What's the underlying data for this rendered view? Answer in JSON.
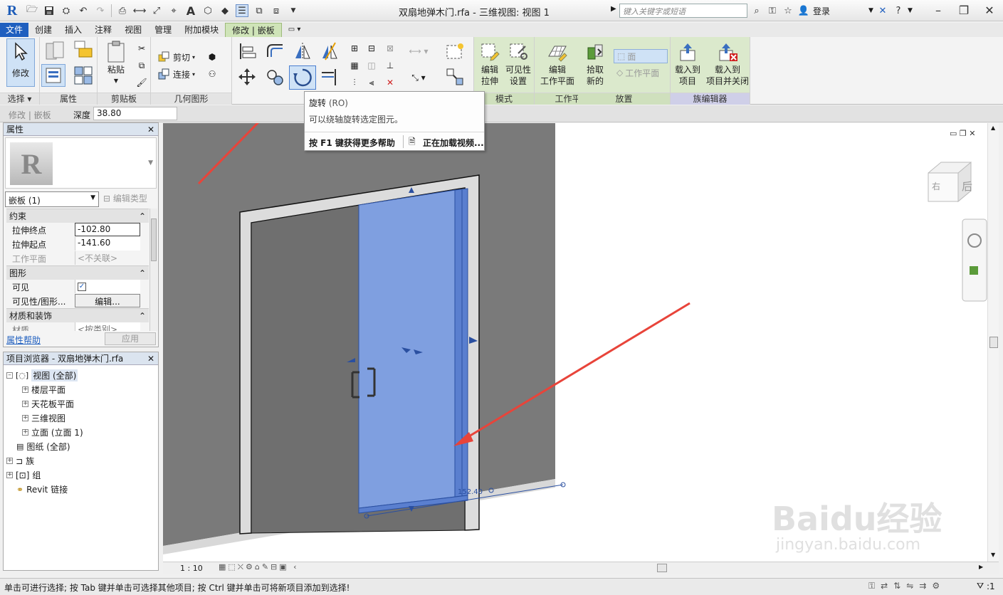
{
  "titlebar": {
    "app_icon": "R",
    "title": "双扇地弹木门.rfa - 三维视图: 视图 1",
    "search_placeholder": "键入关键字或短语",
    "login": "登录"
  },
  "menu_tabs": [
    "文件",
    "创建",
    "插入",
    "注释",
    "视图",
    "管理",
    "附加模块",
    "修改 | 嵌板"
  ],
  "ribbon": {
    "modify_label": "修改",
    "panels": {
      "select": "选择",
      "properties": "属性",
      "clipboard": "剪贴板",
      "geometry": "几何图形",
      "mode": "模式",
      "work_plane": "工作平面",
      "place": "放置",
      "family_editor": "族编辑器"
    },
    "paste": "粘贴",
    "cut": "剪切",
    "join": "连接",
    "edit_extrusion": [
      "编辑",
      "拉伸"
    ],
    "visibility_settings": [
      "可见性",
      "设置"
    ],
    "edit_work_plane": [
      "编辑",
      "工作平面"
    ],
    "pick_new": [
      "拾取",
      "新的"
    ],
    "face": "面",
    "work_plane_btn": "工作平面",
    "load_into_project": [
      "载入到",
      "项目"
    ],
    "load_into_project_close": [
      "载入到",
      "项目并关闭"
    ]
  },
  "tooltip": {
    "title": "旋转",
    "shortcut": "(RO)",
    "description": "可以绕轴旋转选定图元。",
    "f1_help": "按 F1 键获得更多帮助",
    "loading_video": "正在加载视频..."
  },
  "options_bar": {
    "context": "修改 | 嵌板",
    "depth_label": "深度",
    "depth_value": "38.80"
  },
  "properties": {
    "title": "属性",
    "type_selector": "嵌板 (1)",
    "edit_type": "编辑类型",
    "categories": {
      "constraints": "约束",
      "graphics": "图形",
      "materials": "材质和装饰"
    },
    "rows": {
      "extrusion_end": {
        "label": "拉伸终点",
        "value": "-102.80"
      },
      "extrusion_start": {
        "label": "拉伸起点",
        "value": "-141.60"
      },
      "work_plane": {
        "label": "工作平面",
        "value": "<不关联>"
      },
      "visible": {
        "label": "可见"
      },
      "visibility_graphics": {
        "label": "可见性/图形...",
        "value": "编辑..."
      },
      "material": {
        "label": "材质",
        "value": "<按类别>"
      }
    },
    "help_link": "属性帮助",
    "apply": "应用"
  },
  "browser": {
    "title": "项目浏览器 - 双扇地弹木门.rfa",
    "items": [
      {
        "label": "视图 (全部)"
      },
      {
        "label": "楼层平面"
      },
      {
        "label": "天花板平面"
      },
      {
        "label": "三维视图"
      },
      {
        "label": "立面 (立面 1)"
      },
      {
        "label": "图纸 (全部)"
      },
      {
        "label": "族"
      },
      {
        "label": "组"
      },
      {
        "label": "Revit 链接"
      }
    ]
  },
  "viewport": {
    "viewcube_right": "右",
    "viewcube_back": "后",
    "dimension_text": "152.40"
  },
  "view_control": {
    "scale": "1 : 10"
  },
  "status": {
    "message": "单击可进行选择; 按 Tab 键并单击可选择其他项目; 按 Ctrl 键并单击可将新项目添加到选择!",
    "filter_count": ":1"
  },
  "watermark": {
    "brand": "Baidu经验",
    "url": "jingyan.baidu.com"
  },
  "colors": {
    "accent_blue": "#1f5fbf",
    "context_tab_green": "#cfe4b8",
    "door_selected": "#7f9fe0",
    "wall_grey": "#7a7a7a",
    "annotation_arrow": "#e8443a"
  }
}
